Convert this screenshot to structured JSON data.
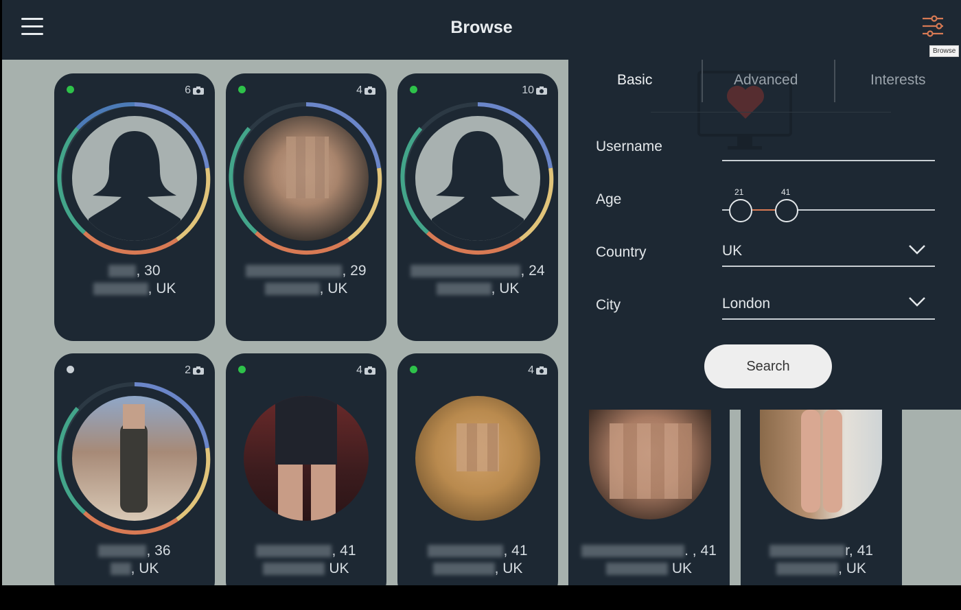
{
  "header": {
    "title": "Browse",
    "filter_tooltip": "Browse"
  },
  "colors": {
    "background": "#1d2833",
    "grid_background": "#a7b1ad",
    "online": "#2ec24a",
    "offline": "#c9d0d6",
    "accent": "#d87a54"
  },
  "profiles": [
    {
      "status": "online",
      "photo_count": "6",
      "name_suffix": ", 30",
      "location_suffix": ", UK",
      "avatar": "placeholder-avatar"
    },
    {
      "status": "online",
      "photo_count": "4",
      "name_suffix": ", 29",
      "location_suffix": ", UK",
      "avatar": "photo"
    },
    {
      "status": "online",
      "photo_count": "10",
      "name_suffix": ", 24",
      "location_suffix": ", UK",
      "avatar": "placeholder-avatar"
    },
    {
      "status": "offline",
      "photo_count": "2",
      "name_suffix": ", 36",
      "location_suffix": ", UK",
      "avatar": "photo"
    },
    {
      "status": "online",
      "photo_count": "4",
      "name_suffix": ", 41",
      "location_suffix": " UK",
      "avatar": "photo"
    },
    {
      "status": "online",
      "photo_count": "4",
      "name_suffix": ", 41",
      "location_suffix": ", UK",
      "avatar": "photo"
    },
    {
      "status": "online",
      "photo_count": "",
      "name_suffix": ". , 41",
      "location_suffix": " UK",
      "avatar": "photo"
    },
    {
      "status": "online",
      "photo_count": "",
      "name_suffix": "r, 41",
      "location_suffix": ", UK",
      "avatar": "photo"
    }
  ],
  "filter_panel": {
    "tabs": [
      "Basic",
      "Advanced",
      "Interests"
    ],
    "active_tab": "Basic",
    "username_label": "Username",
    "username_value": "",
    "age_label": "Age",
    "age_min": "21",
    "age_max": "41",
    "country_label": "Country",
    "country_value": "UK",
    "city_label": "City",
    "city_value": "London",
    "search_label": "Search"
  }
}
